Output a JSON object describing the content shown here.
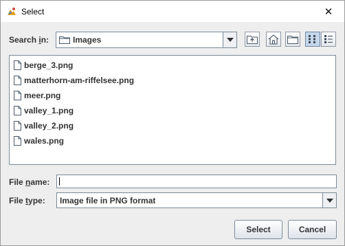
{
  "window": {
    "title": "Select"
  },
  "search": {
    "label_prefix": "Search ",
    "label_mnemonic": "i",
    "label_suffix": "n:",
    "folder": "Images"
  },
  "toolbar": {
    "up_one_level_icon": "folder-up-icon",
    "home_icon": "home-icon",
    "new_folder_icon": "new-folder-icon",
    "list_view_icon": "list-view-icon",
    "details_view_icon": "details-view-icon"
  },
  "files": [
    {
      "name": "berge_3.png"
    },
    {
      "name": "matterhorn-am-riffelsee.png"
    },
    {
      "name": "meer.png"
    },
    {
      "name": "valley_1.png"
    },
    {
      "name": "valley_2.png"
    },
    {
      "name": "wales.png"
    }
  ],
  "filename": {
    "label_prefix": "File ",
    "label_mnemonic": "n",
    "label_suffix": "ame:",
    "value": ""
  },
  "filetype": {
    "label_prefix": "File ",
    "label_mnemonic": "t",
    "label_suffix": "ype:",
    "value": "Image file in PNG format"
  },
  "buttons": {
    "select": "Select",
    "cancel": "Cancel"
  }
}
